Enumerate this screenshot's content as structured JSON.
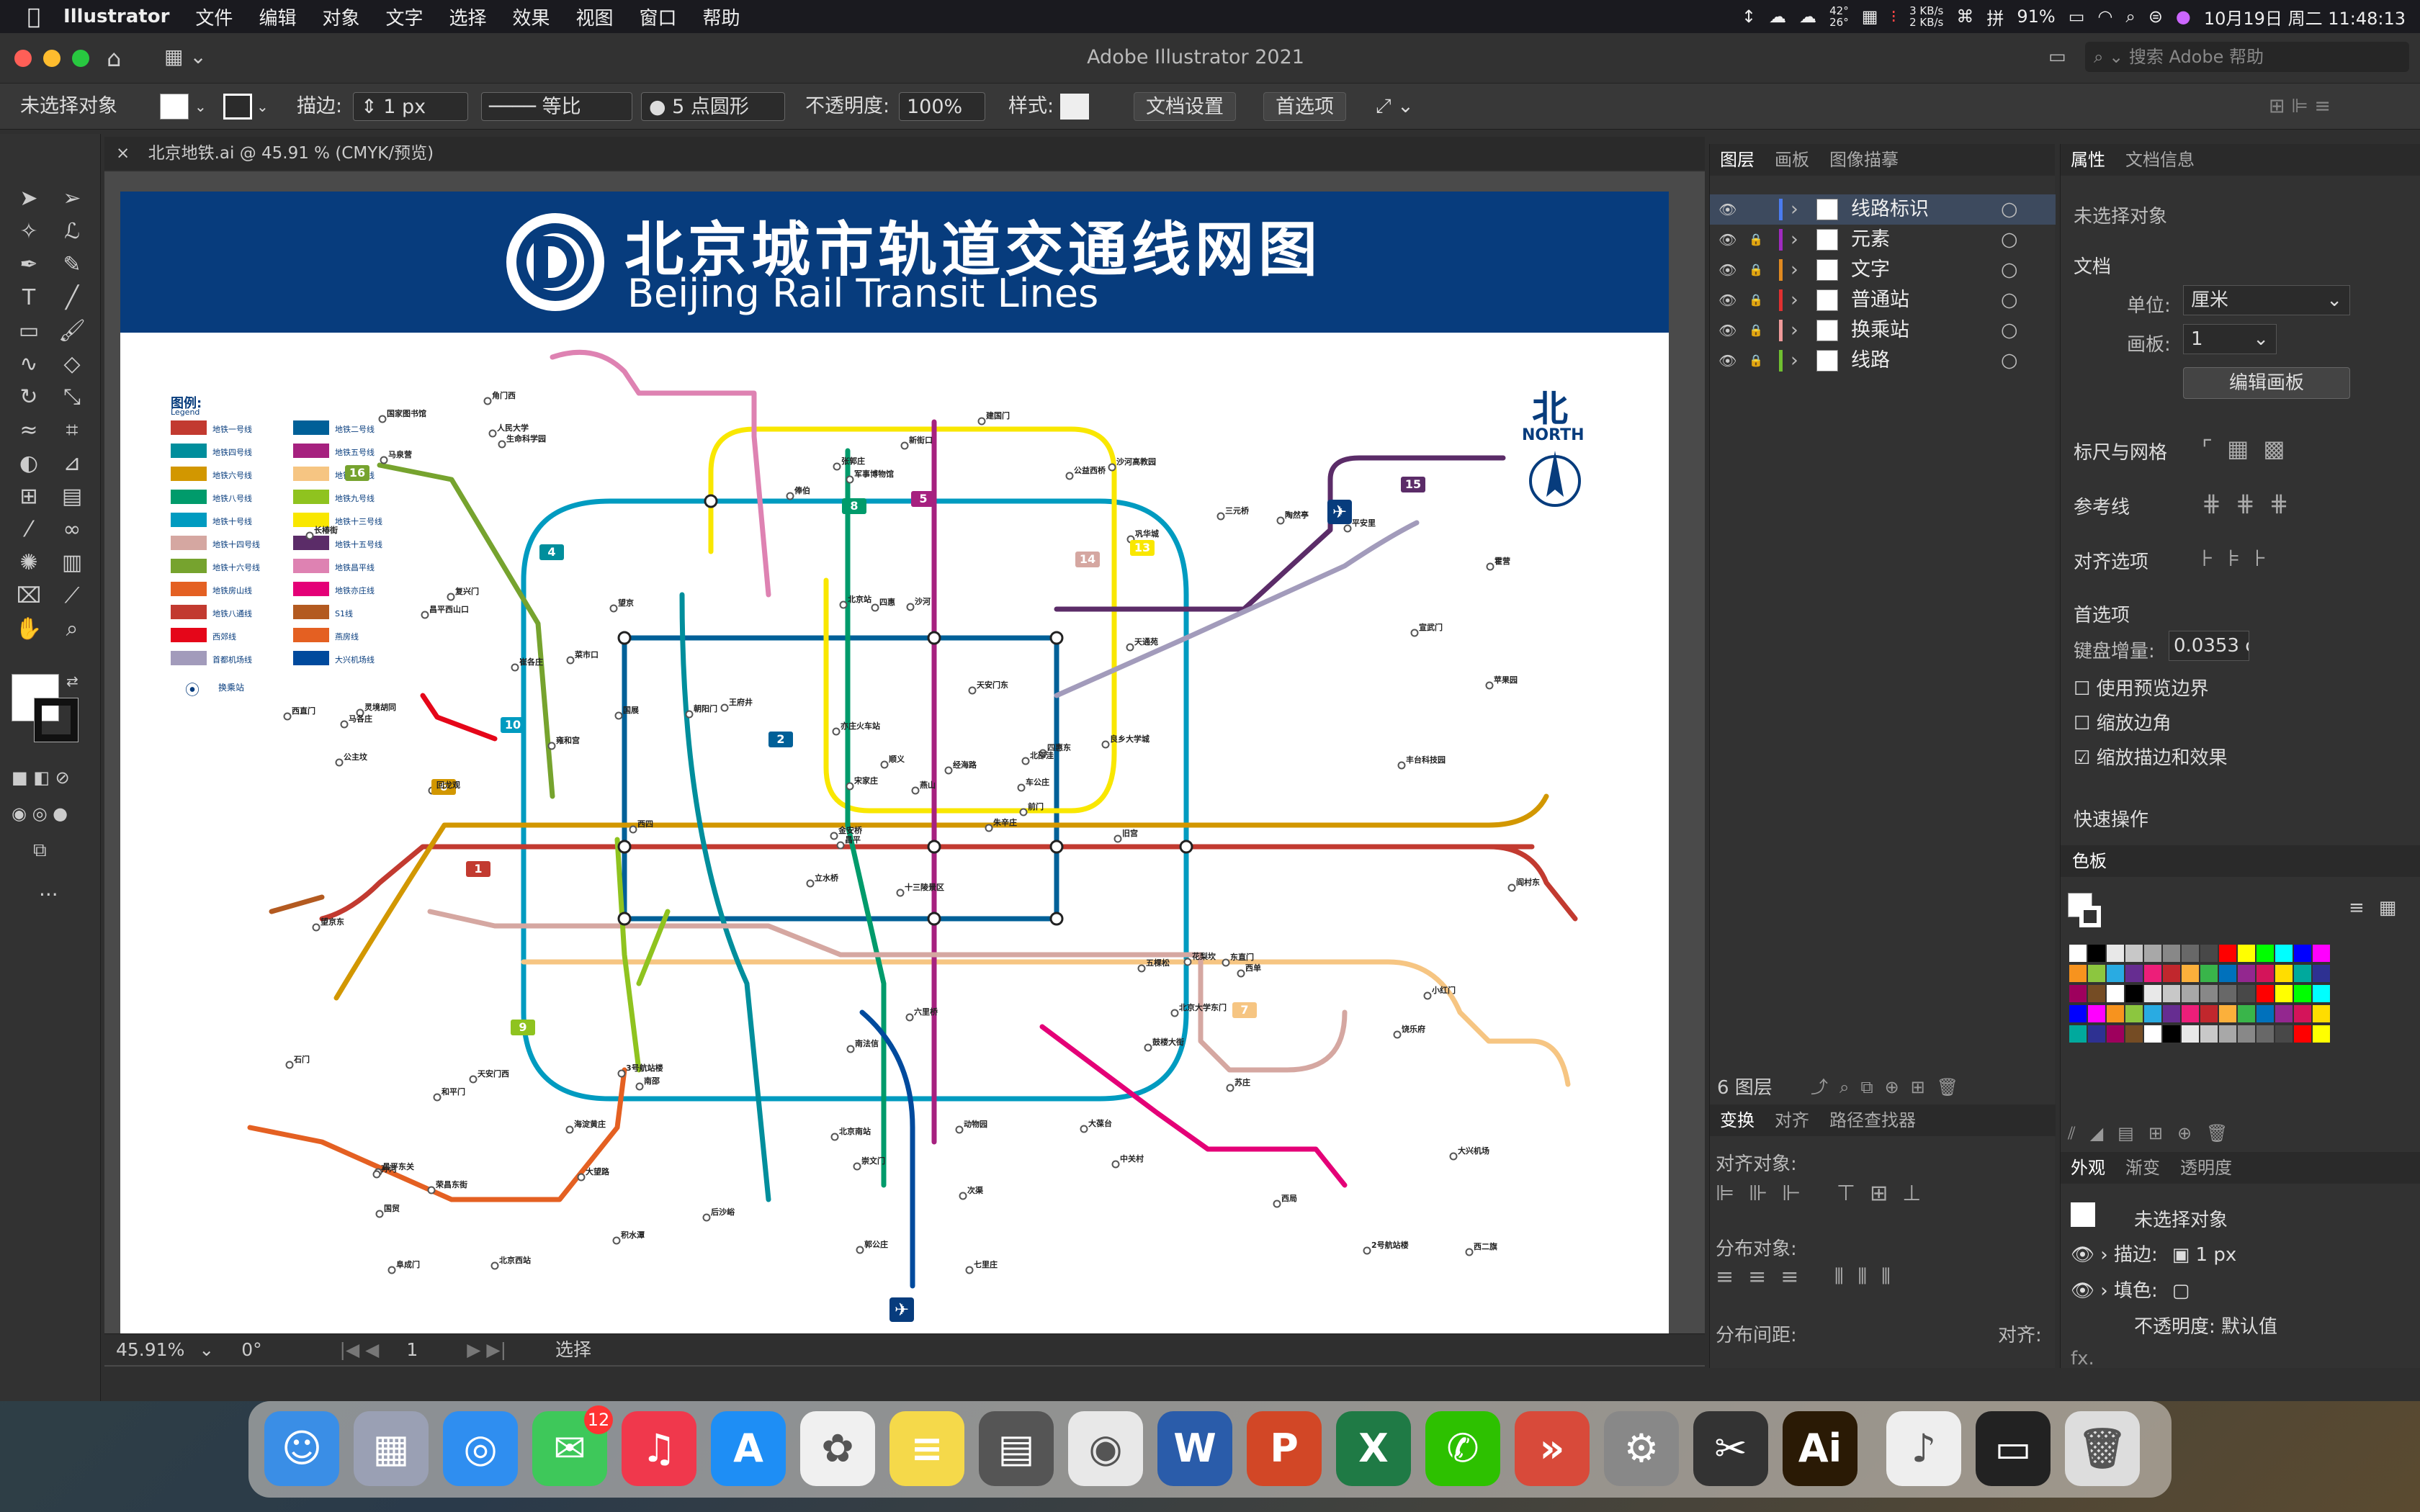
{
  "menubar": {
    "app": "Illustrator",
    "items": [
      "文件",
      "编辑",
      "对象",
      "文字",
      "选择",
      "效果",
      "视图",
      "窗口",
      "帮助"
    ],
    "weather": "42°\n26°",
    "net": "3 KB/s\n2 KB/s",
    "battery": "91%",
    "datetime": "10月19日 周二 11:48:13"
  },
  "window": {
    "title": "Adobe Illustrator 2021",
    "search_placeholder": "搜索 Adobe 帮助"
  },
  "controlbar": {
    "selection": "未选择对象",
    "stroke_label": "描边:",
    "stroke_value": "1 px",
    "profile": "等比",
    "brush": "5 点圆形",
    "opacity_label": "不透明度:",
    "opacity_value": "100%",
    "style_label": "样式:",
    "doc_setup": "文档设置",
    "prefs": "首选项"
  },
  "doc": {
    "tab": "北京地铁.ai @ 45.91 % (CMYK/预览)"
  },
  "map": {
    "title_cn": "北京城市轨道交通线网图",
    "title_en": "Beijing Rail Transit Lines",
    "north_cn": "北",
    "north_en": "NORTH",
    "legend_title": "图例:",
    "legend_title_en": "Legend",
    "legend": [
      {
        "name": "地铁一号线",
        "color": "#c23a30"
      },
      {
        "name": "地铁二号线",
        "color": "#006098"
      },
      {
        "name": "地铁四号线",
        "color": "#008e9c"
      },
      {
        "name": "地铁五号线",
        "color": "#a6217f"
      },
      {
        "name": "地铁六号线",
        "color": "#d29700"
      },
      {
        "name": "地铁七号线",
        "color": "#f6c582"
      },
      {
        "name": "地铁八号线",
        "color": "#009b6b"
      },
      {
        "name": "地铁九号线",
        "color": "#8fc31f"
      },
      {
        "name": "地铁十号线",
        "color": "#009bc0"
      },
      {
        "name": "地铁十三号线",
        "color": "#f9e700"
      },
      {
        "name": "地铁十四号线",
        "color": "#d5a7a1"
      },
      {
        "name": "地铁十五号线",
        "color": "#5b2c68"
      },
      {
        "name": "地铁十六号线",
        "color": "#76a32e"
      },
      {
        "name": "地铁昌平线",
        "color": "#de82b2"
      },
      {
        "name": "地铁房山线",
        "color": "#e46022"
      },
      {
        "name": "地铁亦庄线",
        "color": "#e40077"
      },
      {
        "name": "地铁八通线",
        "color": "#c23a30"
      },
      {
        "name": "S1线",
        "color": "#b35a20"
      },
      {
        "name": "西郊线",
        "color": "#e50619"
      },
      {
        "name": "燕房线",
        "color": "#e46022"
      },
      {
        "name": "首都机场线",
        "color": "#a29bbb"
      },
      {
        "name": "大兴机场线",
        "color": "#004a9d"
      }
    ],
    "transfer_label": "换乘站",
    "line_badges": [
      {
        "num": "16"
      },
      {
        "num": "4"
      },
      {
        "num": "10"
      },
      {
        "num": "8"
      },
      {
        "num": "5"
      },
      {
        "num": "13"
      },
      {
        "num": "15"
      },
      {
        "num": "14"
      },
      {
        "num": "6"
      },
      {
        "num": "2"
      },
      {
        "num": "1"
      },
      {
        "num": "9"
      },
      {
        "num": "7"
      }
    ],
    "stations": [
      "十三陵景区",
      "昌平西山口",
      "昌平",
      "昌平东关",
      "北邵洼",
      "南邵",
      "沙河高教园",
      "沙河",
      "巩华城",
      "朱辛庄",
      "生命科学园",
      "西二旗",
      "回龙观",
      "霍营",
      "立水桥",
      "天通苑",
      "北京西站",
      "北京站",
      "天安门东",
      "天安门西",
      "王府井",
      "国贸",
      "大望路",
      "四惠",
      "四惠东",
      "西单",
      "复兴门",
      "军事博物馆",
      "公主坟",
      "五棵松",
      "苹果园",
      "金安桥",
      "北京南站",
      "宋家庄",
      "望京",
      "三元桥",
      "3号航站楼",
      "2号航站楼",
      "大兴机场",
      "东直门",
      "建国门",
      "朝阳门",
      "雍和宫",
      "鼓楼大街",
      "积水潭",
      "西直门",
      "车公庄",
      "阜成门",
      "崇文门",
      "前门",
      "和平门",
      "宣武门",
      "长椿街",
      "北京大学东门",
      "中关村",
      "海淀黄庄",
      "人民大学",
      "国家图书馆",
      "动物园",
      "平安里",
      "新街口",
      "西四",
      "灵境胡同",
      "菜市口",
      "陶然亭",
      "角门西",
      "公益西桥",
      "俸伯",
      "顺义",
      "石门",
      "南法信",
      "后沙峪",
      "花梨坎",
      "国展",
      "孙河",
      "马泉营",
      "崔各庄",
      "望京东",
      "亦庄火车站",
      "次渠",
      "经海路",
      "荣昌东街",
      "旧宫",
      "小红门",
      "郭公庄",
      "丰台科技园",
      "六里桥",
      "西局",
      "七里庄",
      "大葆台",
      "张郭庄",
      "阎村东",
      "良乡大学城",
      "苏庄",
      "燕山",
      "饶乐府",
      "马各庄"
    ]
  },
  "panels": {
    "layers_tabs": [
      "图层",
      "画板",
      "图像描摹"
    ],
    "layers": [
      {
        "name": "线路标识",
        "color": "#4a7cf0"
      },
      {
        "name": "元素",
        "color": "#a02ac0"
      },
      {
        "name": "文字",
        "color": "#e08a20"
      },
      {
        "name": "普通站",
        "color": "#e03030"
      },
      {
        "name": "换乘站",
        "color": "#f09a9a"
      },
      {
        "name": "线路",
        "color": "#70c030"
      }
    ],
    "layers_count": "6 图层",
    "align_tabs": [
      "变换",
      "对齐",
      "路径查找器"
    ],
    "align_objects": "对齐对象:",
    "distribute_objects": "分布对象:",
    "distribute_spacing": "分布间距:",
    "align_to": "对齐:",
    "props_tabs": [
      "属性",
      "文档信息"
    ],
    "props_none": "未选择对象",
    "doc_label": "文档",
    "unit_label": "单位:",
    "unit_value": "厘米",
    "artboard_label": "画板:",
    "artboard_value": "1",
    "edit_artboard": "编辑画板",
    "rulers_grid": "标尺与网格",
    "guides": "参考线",
    "snap": "对齐选项",
    "prefs": "首选项",
    "key_inc_label": "键盘增量:",
    "key_inc_value": "0.0353 c",
    "cb1": "使用预览边界",
    "cb2": "缩放边角",
    "cb3": "缩放描边和效果",
    "quick_actions": "快速操作",
    "swatches": "色板",
    "appearance_tabs": [
      "外观",
      "渐变",
      "透明度"
    ],
    "app_none": "未选择对象",
    "app_stroke": "描边:",
    "app_stroke_val": "1 px",
    "app_fill": "填色:",
    "app_opacity": "不透明度: 默认值",
    "fx": "fx."
  },
  "status": {
    "zoom": "45.91%",
    "angle": "0°",
    "page": "1",
    "tool": "选择"
  },
  "dock": [
    {
      "name": "Finder",
      "color": "#3a8ee6",
      "glyph": "☺"
    },
    {
      "name": "Launchpad",
      "color": "#9aa0b4",
      "glyph": "▦"
    },
    {
      "name": "Safari",
      "color": "#2f8ef0",
      "glyph": "◎"
    },
    {
      "name": "Messages",
      "color": "#3ec85a",
      "glyph": "✉",
      "badge": "12"
    },
    {
      "name": "Music",
      "color": "#f0384c",
      "glyph": "♫"
    },
    {
      "name": "App Store",
      "color": "#1e8ef5",
      "glyph": "A"
    },
    {
      "name": "Photos",
      "color": "#f0f0f0",
      "glyph": "✿"
    },
    {
      "name": "Notes",
      "color": "#f5d94a",
      "glyph": "≡"
    },
    {
      "name": "Calculator",
      "color": "#555",
      "glyph": "▤"
    },
    {
      "name": "Chrome",
      "color": "#e8e8e8",
      "glyph": "◉"
    },
    {
      "name": "Word",
      "color": "#2a5caa",
      "glyph": "W"
    },
    {
      "name": "PowerPoint",
      "color": "#d24726",
      "glyph": "P"
    },
    {
      "name": "Excel",
      "color": "#1f7a45",
      "glyph": "X"
    },
    {
      "name": "WeChat",
      "color": "#2dc100",
      "glyph": "✆"
    },
    {
      "name": "Remote",
      "color": "#d84a3a",
      "glyph": "»"
    },
    {
      "name": "System Preferences",
      "color": "#888",
      "glyph": "⚙"
    },
    {
      "name": "Final Cut",
      "color": "#333",
      "glyph": "✂"
    },
    {
      "name": "Illustrator",
      "color": "#2a1a05",
      "glyph": "Ai"
    },
    {
      "name": "Music File",
      "color": "#eee",
      "glyph": "♪"
    },
    {
      "name": "Screen",
      "color": "#222",
      "glyph": "▭"
    },
    {
      "name": "Trash",
      "color": "#ddd",
      "glyph": "🗑"
    }
  ]
}
